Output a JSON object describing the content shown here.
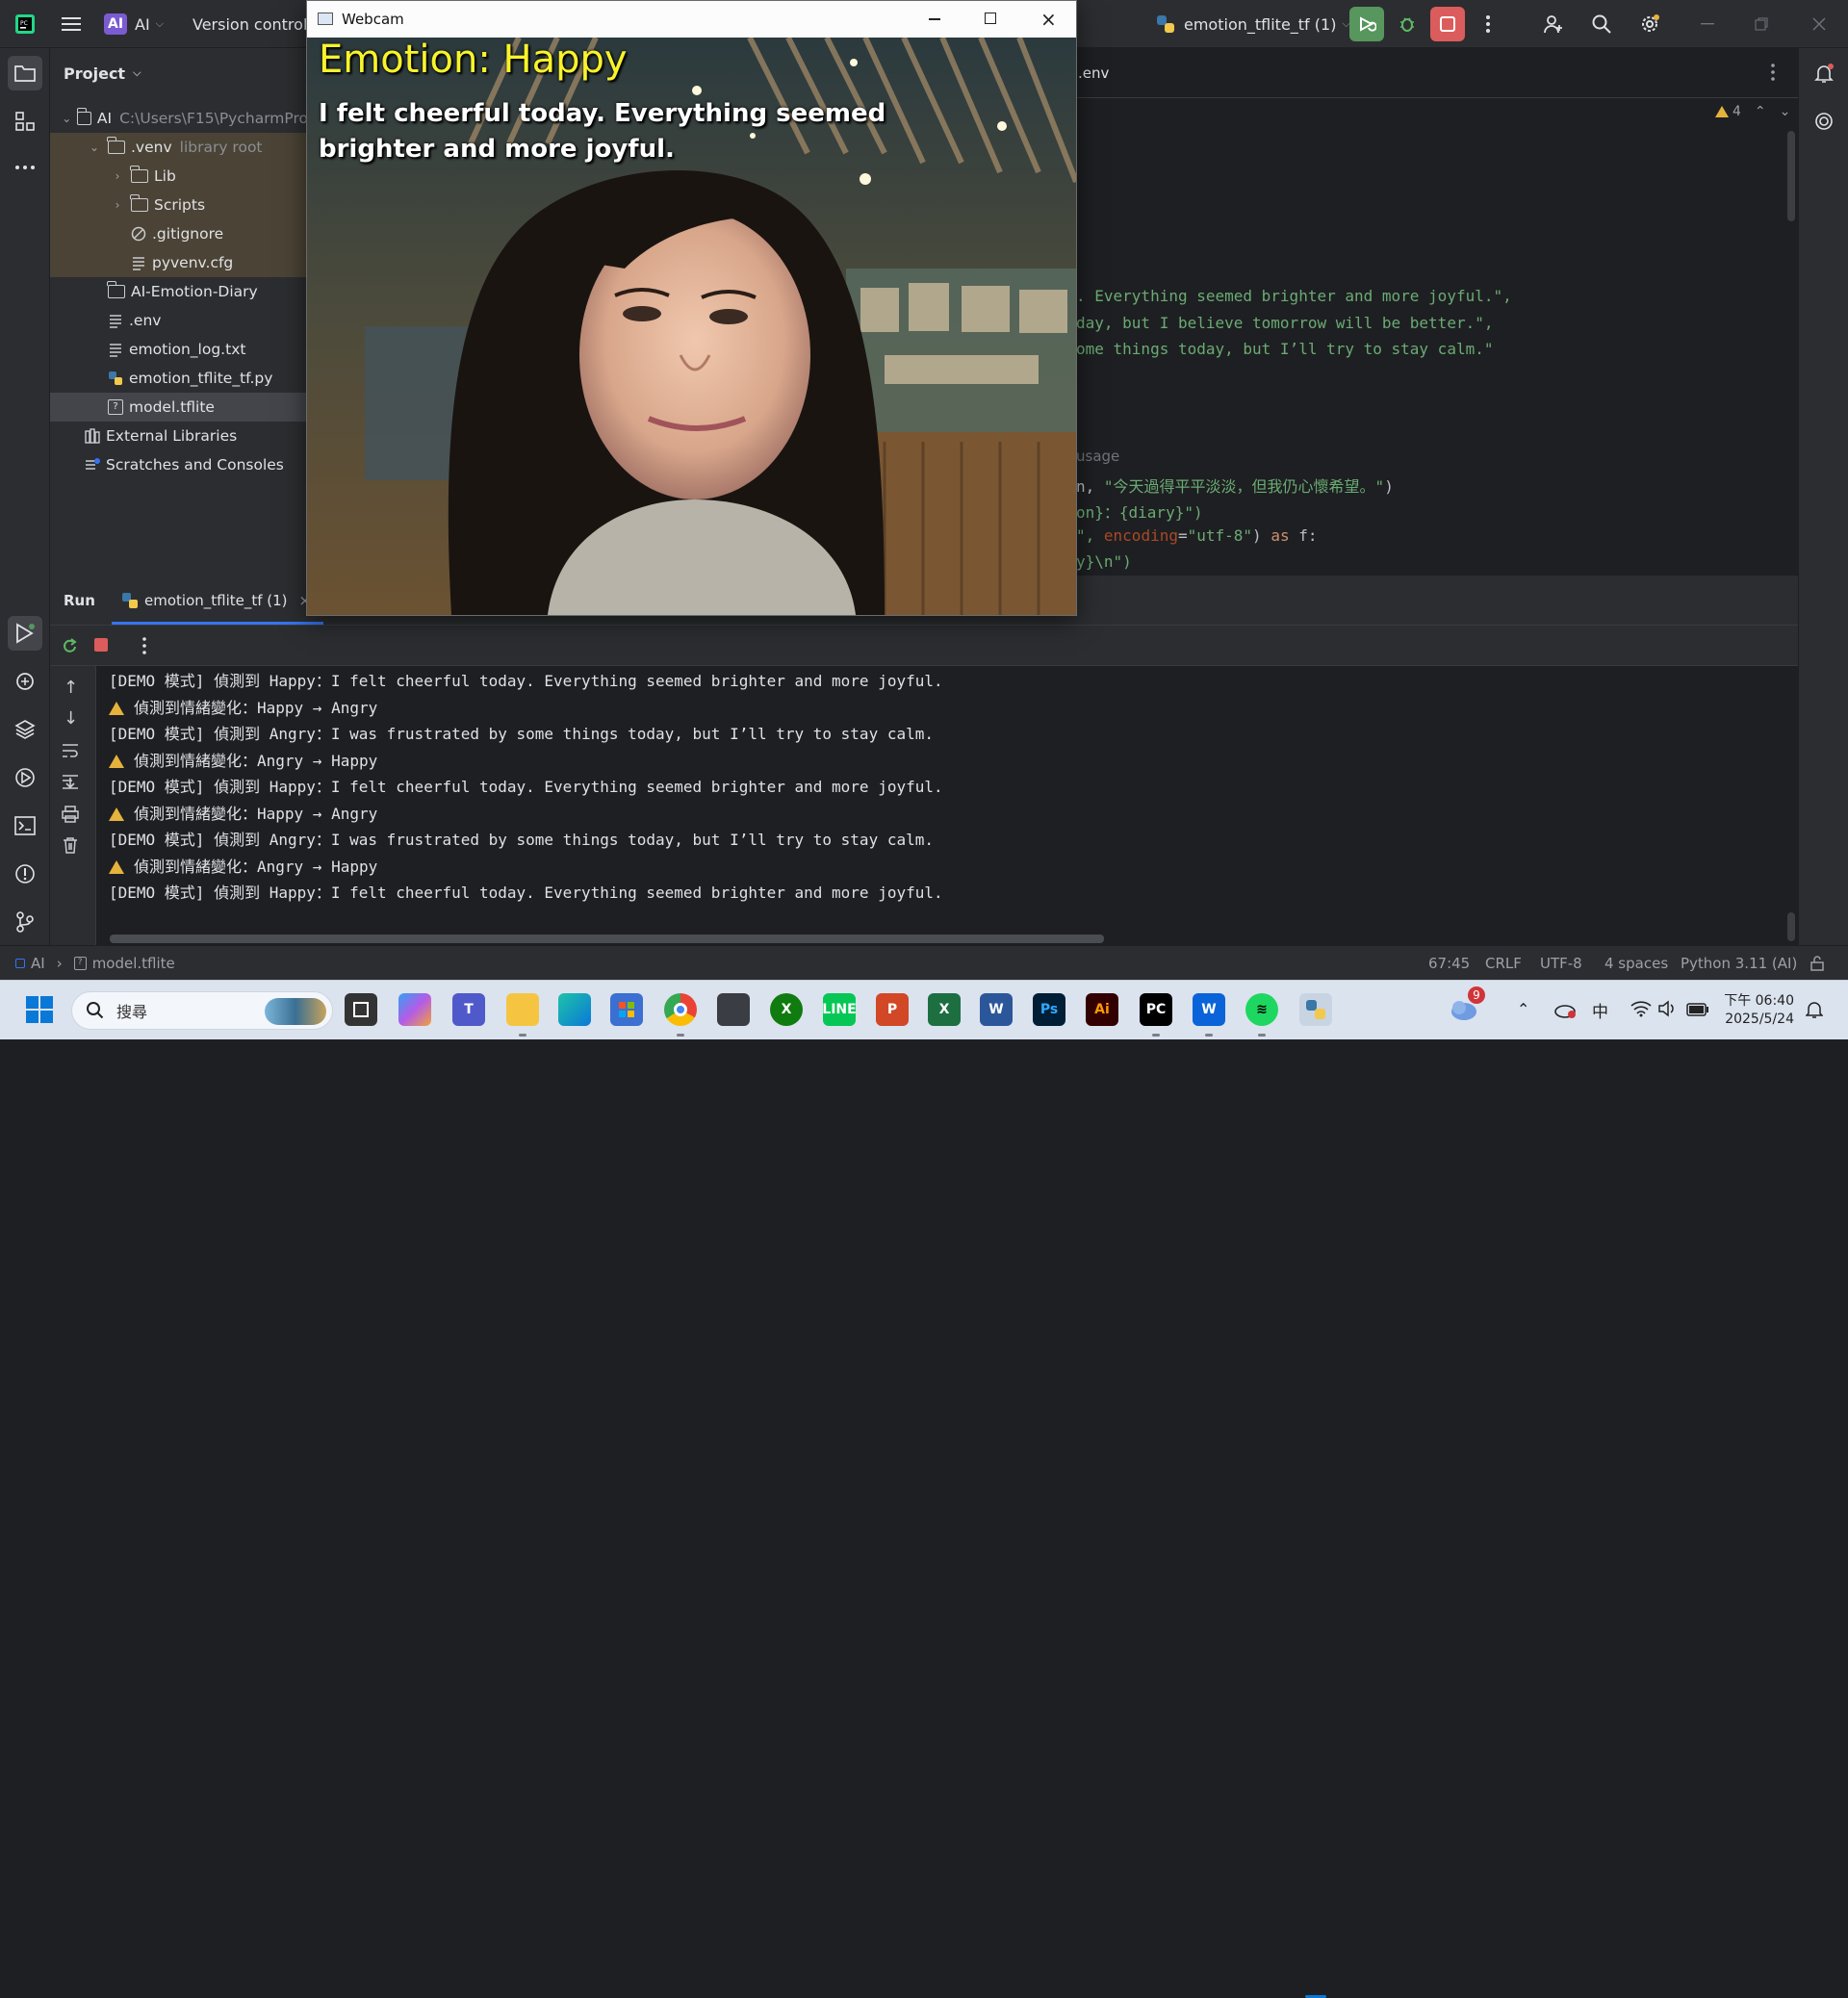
{
  "ide": {
    "project_badge": "AI",
    "project_name": "AI",
    "version_control": "Version control",
    "run_config": "emotion_tflite_tf (1)"
  },
  "project_panel": {
    "title": "Project",
    "tree": [
      {
        "label": "AI",
        "hint": "C:\\Users\\F15\\PycharmPro",
        "type": "folder",
        "level": 0,
        "expanded": true
      },
      {
        "label": ".venv",
        "hint": "library root",
        "type": "folder",
        "level": 1,
        "expanded": true
      },
      {
        "label": "Lib",
        "hint": "",
        "type": "folder",
        "level": 2,
        "expanded": false
      },
      {
        "label": "Scripts",
        "hint": "",
        "type": "folder",
        "level": 2,
        "expanded": false
      },
      {
        "label": ".gitignore",
        "hint": "",
        "type": "ignore",
        "level": 2
      },
      {
        "label": "pyvenv.cfg",
        "hint": "",
        "type": "text",
        "level": 2
      },
      {
        "label": "AI-Emotion-Diary",
        "hint": "",
        "type": "folder",
        "level": 1
      },
      {
        "label": ".env",
        "hint": "",
        "type": "text",
        "level": 1
      },
      {
        "label": "emotion_log.txt",
        "hint": "",
        "type": "text",
        "level": 1
      },
      {
        "label": "emotion_tflite_tf.py",
        "hint": "",
        "type": "python",
        "level": 1
      },
      {
        "label": "model.tflite",
        "hint": "",
        "type": "unknown",
        "level": 1,
        "selected": true
      },
      {
        "label": "External Libraries",
        "hint": "",
        "type": "library",
        "level": 0
      },
      {
        "label": "Scratches and Consoles",
        "hint": "",
        "type": "scratch",
        "level": 0
      }
    ]
  },
  "editor": {
    "tab_label": ".env",
    "warnings_count": "4",
    "usage_hint": "usage",
    "lines": [
      {
        "parts": [
          {
            "t": ". Everything seemed brighter and more joyful.\",",
            "c": "str"
          }
        ]
      },
      {
        "parts": [
          {
            "t": "day, but I believe tomorrow will be better.\",",
            "c": "str"
          }
        ]
      },
      {
        "parts": [
          {
            "t": "ome things today, but I’ll try to stay calm.\"",
            "c": "str"
          }
        ]
      },
      {
        "parts": [
          {
            "t": "n, ",
            "c": "plain"
          },
          {
            "t": "\"今天過得平平淡淡，但我仍心懷希望。\"",
            "c": "str"
          },
          {
            "t": ")",
            "c": "plain"
          }
        ]
      },
      {
        "parts": [
          {
            "t": "on}：{diary}\")",
            "c": "str"
          }
        ]
      },
      {
        "parts": [
          {
            "t": "\", ",
            "c": "str"
          },
          {
            "t": "encoding",
            "c": "par"
          },
          {
            "t": "=",
            "c": "plain"
          },
          {
            "t": "\"utf-8\"",
            "c": "str"
          },
          {
            "t": ") ",
            "c": "plain"
          },
          {
            "t": "as",
            "c": "kw"
          },
          {
            "t": " f:",
            "c": "plain"
          }
        ]
      },
      {
        "parts": [
          {
            "t": "y}\\n\")",
            "c": "str"
          }
        ]
      }
    ]
  },
  "run": {
    "title": "Run",
    "tab": "emotion_tflite_tf (1)",
    "console": [
      {
        "warn": false,
        "text": "[DEMO 模式] 偵測到 Happy：I felt cheerful today. Everything seemed brighter and more joyful."
      },
      {
        "warn": true,
        "text": "偵測到情緒變化：Happy → Angry"
      },
      {
        "warn": false,
        "text": "[DEMO 模式] 偵測到 Angry：I was frustrated by some things today, but I’ll try to stay calm."
      },
      {
        "warn": true,
        "text": "偵測到情緒變化：Angry → Happy"
      },
      {
        "warn": false,
        "text": "[DEMO 模式] 偵測到 Happy：I felt cheerful today. Everything seemed brighter and more joyful."
      },
      {
        "warn": true,
        "text": "偵測到情緒變化：Happy → Angry"
      },
      {
        "warn": false,
        "text": "[DEMO 模式] 偵測到 Angry：I was frustrated by some things today, but I’ll try to stay calm."
      },
      {
        "warn": true,
        "text": "偵測到情緒變化：Angry → Happy"
      },
      {
        "warn": false,
        "text": "[DEMO 模式] 偵測到 Happy：I felt cheerful today. Everything seemed brighter and more joyful."
      }
    ]
  },
  "status_bar": {
    "breadcrumb_project": "AI",
    "breadcrumb_file": "model.tflite",
    "position": "67:45",
    "line_sep": "CRLF",
    "encoding": "UTF-8",
    "indent": "4 spaces",
    "interpreter": "Python 3.11 (AI)"
  },
  "webcam": {
    "window_title": "Webcam",
    "emotion_text": "Emotion: Happy",
    "diary_line1": "I felt cheerful today. Everything seemed",
    "diary_line2": "brighter and more joyful."
  },
  "taskbar": {
    "search_placeholder": "搜尋",
    "weather_badge": "9",
    "ime": "中",
    "time": "下午 06:40",
    "date": "2025/5/24"
  },
  "colors": {
    "ide_bg": "#1e1f22",
    "panel_bg": "#2b2d30",
    "accent_green": "#57965c",
    "stop_red": "#db5c5c",
    "string_green": "#6aab73",
    "emotion_yellow": "#f8f32b"
  }
}
